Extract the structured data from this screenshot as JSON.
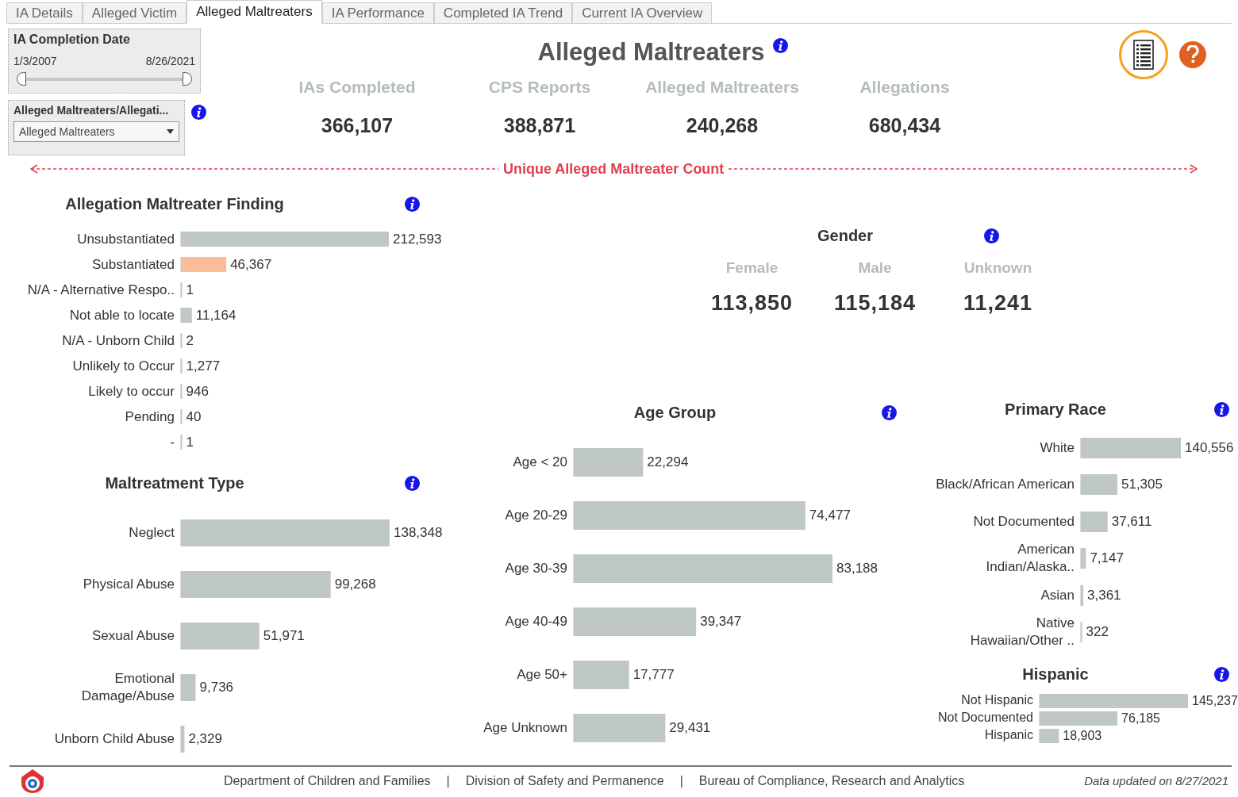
{
  "tabs": [
    {
      "label": "IA Details",
      "selected": false
    },
    {
      "label": "Alleged Victim",
      "selected": false
    },
    {
      "label": "Alleged Maltreaters",
      "selected": true
    },
    {
      "label": "IA Performance",
      "selected": false
    },
    {
      "label": "Completed IA Trend",
      "selected": false
    },
    {
      "label": "Current IA Overview",
      "selected": false
    }
  ],
  "date_filter": {
    "title": "IA Completion Date",
    "start": "1/3/2007",
    "end": "8/26/2021",
    "level": 1
  },
  "measure_filter": {
    "title": "Alleged Maltreaters/Allegati...",
    "value": "Alleged Maltreaters"
  },
  "title": "Alleged Maltreaters",
  "kpis": [
    {
      "label": "IAs Completed",
      "value": "366,107"
    },
    {
      "label": "CPS Reports",
      "value": "388,871"
    },
    {
      "label": "Alleged Maltreaters",
      "value": "240,268"
    },
    {
      "label": "Allegations",
      "value": "680,434"
    }
  ],
  "divider_label": "Unique Alleged Maltreater Count",
  "finding": {
    "chart_data": {
      "type": "bar",
      "orientation": "horizontal",
      "title": "Allegation Maltreater Finding",
      "stacked": true,
      "categories": [
        "Unsubstantiated",
        "Substantiated",
        "N/A - Alternative Respo..",
        "Not able to locate",
        "N/A - Unborn Child",
        "Unlikely to Occur",
        "Likely to occur",
        "Pending",
        "-"
      ],
      "series": [
        {
          "color": "#c0c8c4",
          "values": [
            212593,
            null,
            1,
            11164,
            2,
            1277,
            946,
            40,
            1
          ],
          "value_labels": [
            "212,593",
            null,
            "1",
            "11,164",
            "2",
            "1,277",
            "946",
            "40",
            "1"
          ]
        },
        {
          "color": "#fbbc9a",
          "values": [
            null,
            46367,
            null,
            null,
            null,
            null,
            null,
            null,
            null
          ],
          "value_labels": [
            null,
            "46,367",
            null,
            null,
            null,
            null,
            null,
            null,
            null
          ]
        }
      ]
    }
  },
  "maltreatment_type": {
    "chart_data": {
      "type": "bar",
      "orientation": "horizontal",
      "title": "Maltreatment Type",
      "categories": [
        "Neglect",
        "Physical Abuse",
        "Sexual Abuse",
        "Emotional\nDamage/Abuse",
        "Unborn Child Abuse"
      ],
      "series": [
        {
          "color": "#c0c8c4",
          "values": [
            138348,
            99268,
            51971,
            9736,
            2329
          ],
          "value_labels": [
            "138,348",
            "99,268",
            "51,971",
            "9,736",
            "2,329"
          ]
        }
      ]
    }
  },
  "gender": {
    "title": "Gender",
    "items": [
      {
        "label": "Female",
        "value": "113,850"
      },
      {
        "label": "Male",
        "value": "115,184"
      },
      {
        "label": "Unknown",
        "value": "11,241"
      }
    ]
  },
  "age_group": {
    "chart_data": {
      "type": "bar",
      "orientation": "horizontal",
      "title": "Age Group",
      "categories": [
        "Age < 20",
        "Age 20-29",
        "Age 30-39",
        "Age 40-49",
        "Age 50+",
        "Age Unknown"
      ],
      "series": [
        {
          "color": "#c0c8c4",
          "values": [
            22294,
            74477,
            83188,
            39347,
            17777,
            29431
          ],
          "value_labels": [
            "22,294",
            "74,477",
            "83,188",
            "39,347",
            "17,777",
            "29,431"
          ]
        }
      ]
    }
  },
  "primary_race": {
    "chart_data": {
      "type": "bar",
      "orientation": "horizontal",
      "title": "Primary Race",
      "categories": [
        "White",
        "Black/African American",
        "Not Documented",
        "American\nIndian/Alaska..",
        "Asian",
        "Native\nHawaiian/Other .."
      ],
      "series": [
        {
          "color": "#c0c8c4",
          "values": [
            140556,
            51305,
            37611,
            7147,
            3361,
            322
          ],
          "value_labels": [
            "140,556",
            "51,305",
            "37,611",
            "7,147",
            "3,361",
            "322"
          ]
        }
      ]
    }
  },
  "hispanic": {
    "chart_data": {
      "type": "bar",
      "orientation": "horizontal",
      "title": "Hispanic",
      "categories": [
        "Not Hispanic",
        "Not Documented",
        "Hispanic"
      ],
      "series": [
        {
          "color": "#c0c8c4",
          "values": [
            145237,
            76185,
            18903
          ],
          "value_labels": [
            "145,237",
            "76,185",
            "18,903"
          ]
        }
      ]
    }
  },
  "footer": {
    "parts": [
      {
        "kind": "text",
        "text": "Department of Children and Families"
      },
      {
        "kind": "separator",
        "text": "|"
      },
      {
        "kind": "text",
        "text": "Division of Safety and Permanence"
      },
      {
        "kind": "separator",
        "text": "|"
      },
      {
        "kind": "text",
        "text": "Bureau of Compliance, Research and Analytics"
      }
    ],
    "updated": "Data updated on 8/27/2021"
  }
}
